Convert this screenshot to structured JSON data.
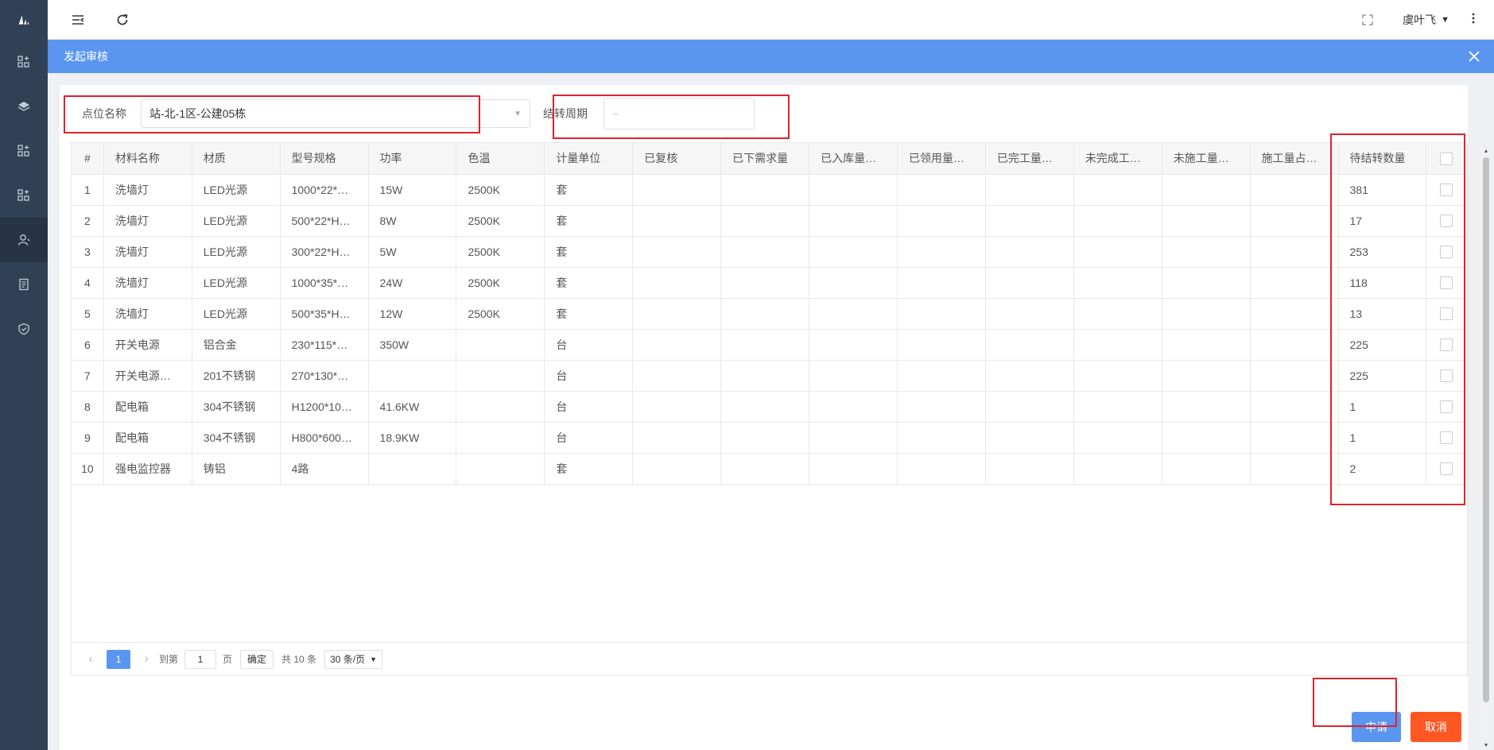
{
  "sidebar": {
    "logo": "L",
    "items": [
      {
        "icon": "dashboard-icon"
      },
      {
        "icon": "layers-icon"
      },
      {
        "icon": "apps-icon"
      },
      {
        "icon": "apps-icon"
      },
      {
        "icon": "user-icon",
        "active": true
      },
      {
        "icon": "document-icon"
      },
      {
        "icon": "shield-icon"
      }
    ]
  },
  "header": {
    "user_name": "虞叶飞"
  },
  "modal": {
    "title": "发起审核"
  },
  "filter": {
    "location_label": "点位名称",
    "location_value": "站-北-1区-公建05栋",
    "period_label": "结转周期",
    "period_value": "~"
  },
  "table": {
    "headers": [
      "#",
      "材料名称",
      "材质",
      "型号规格",
      "功率",
      "色温",
      "计量单位",
      "已复核",
      "已下需求量",
      "已入库量…",
      "已领用量…",
      "已完工量…",
      "未完成工…",
      "未施工量…",
      "施工量占…",
      "待结转数量"
    ],
    "rows": [
      [
        "1",
        "洗墙灯",
        "LED光源",
        "1000*22*…",
        "15W",
        "2500K",
        "套",
        "",
        "",
        "",
        "",
        "",
        "",
        "",
        "",
        "381"
      ],
      [
        "2",
        "洗墙灯",
        "LED光源",
        "500*22*H…",
        "8W",
        "2500K",
        "套",
        "",
        "",
        "",
        "",
        "",
        "",
        "",
        "",
        "17"
      ],
      [
        "3",
        "洗墙灯",
        "LED光源",
        "300*22*H…",
        "5W",
        "2500K",
        "套",
        "",
        "",
        "",
        "",
        "",
        "",
        "",
        "",
        "253"
      ],
      [
        "4",
        "洗墙灯",
        "LED光源",
        "1000*35*…",
        "24W",
        "2500K",
        "套",
        "",
        "",
        "",
        "",
        "",
        "",
        "",
        "",
        "118"
      ],
      [
        "5",
        "洗墙灯",
        "LED光源",
        "500*35*H…",
        "12W",
        "2500K",
        "套",
        "",
        "",
        "",
        "",
        "",
        "",
        "",
        "",
        "13"
      ],
      [
        "6",
        "开关电源",
        "铝合金",
        "230*115*…",
        "350W",
        "",
        "台",
        "",
        "",
        "",
        "",
        "",
        "",
        "",
        "",
        "225"
      ],
      [
        "7",
        "开关电源…",
        "201不锈钢",
        "270*130*…",
        "",
        "",
        "台",
        "",
        "",
        "",
        "",
        "",
        "",
        "",
        "",
        "225"
      ],
      [
        "8",
        "配电箱",
        "304不锈钢",
        "H1200*10…",
        "41.6KW",
        "",
        "台",
        "",
        "",
        "",
        "",
        "",
        "",
        "",
        "",
        "1"
      ],
      [
        "9",
        "配电箱",
        "304不锈钢",
        "H800*600…",
        "18.9KW",
        "",
        "台",
        "",
        "",
        "",
        "",
        "",
        "",
        "",
        "",
        "1"
      ],
      [
        "10",
        "强电监控器",
        "铸铝",
        "4路",
        "",
        "",
        "套",
        "",
        "",
        "",
        "",
        "",
        "",
        "",
        "",
        "2"
      ]
    ]
  },
  "pager": {
    "prev": "‹",
    "current": "1",
    "next": "›",
    "goto_label": "到第",
    "goto_value": "1",
    "page_suffix": "页",
    "confirm": "确定",
    "total": "共 10 条",
    "page_size": "30 条/页"
  },
  "actions": {
    "apply": "申请",
    "cancel": "取消"
  },
  "colors": {
    "accent": "#5a96f0",
    "cancel": "#ff5722",
    "sidebar": "#304156",
    "highlight": "#e0212b"
  }
}
